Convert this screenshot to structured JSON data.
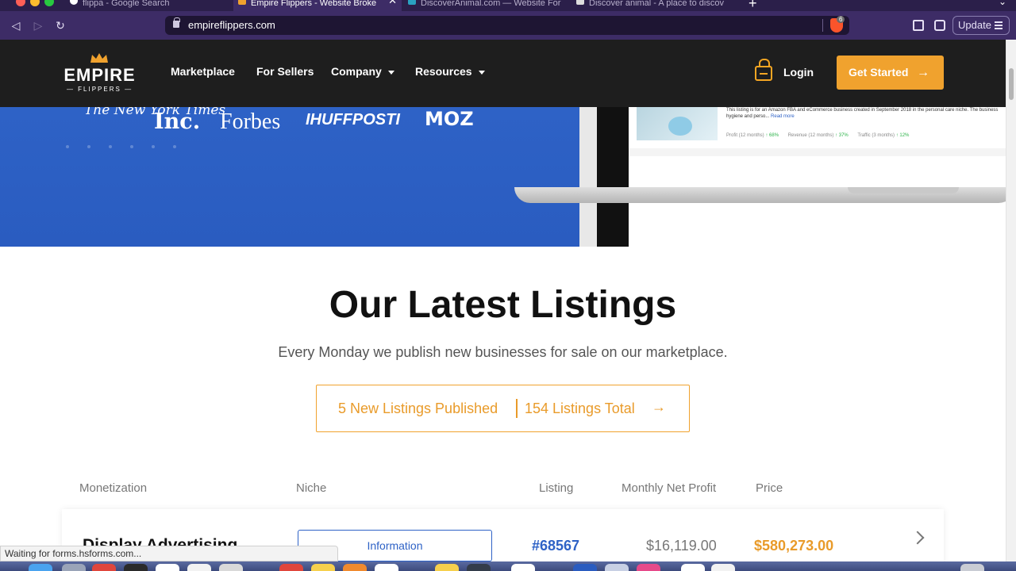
{
  "browser": {
    "tabs": [
      {
        "title": "flippa - Google Search",
        "active": false
      },
      {
        "title": "Empire Flippers - Website Broke",
        "active": true
      },
      {
        "title": "DiscoverAnimal.com — Website For",
        "active": false
      },
      {
        "title": "Discover animal - A place to discov",
        "active": false
      }
    ],
    "url": "empireflippers.com",
    "update_label": "Update",
    "brave_badge": "6",
    "status_text": "Waiting for forms.hsforms.com..."
  },
  "header": {
    "logo_word": "EMPIRE",
    "logo_sub": "— FLIPPERS —",
    "nav": [
      {
        "label": "Marketplace"
      },
      {
        "label": "For Sellers"
      },
      {
        "label": "Company"
      },
      {
        "label": "Resources"
      }
    ],
    "login_label": "Login",
    "cta_label": "Get Started",
    "colors": {
      "accent": "#f0a22e",
      "dark": "#1e1e1e"
    }
  },
  "hero": {
    "press": [
      "The New York Times",
      "Inc.",
      "Forbes",
      "IHUFFPOSTI",
      "MOZ"
    ],
    "preview": {
      "description": "This listing is for an Amazon FBA and eCommerce business created in September 2018 in the personal care niche. The business hygiene and perso...",
      "read_more": "Read more",
      "stats": [
        {
          "label": "Profit (12 months)",
          "value": "↑ 68%"
        },
        {
          "label": "Revenue (12 months)",
          "value": "↑ 37%"
        },
        {
          "label": "Traffic (3 months)",
          "value": "↑ 12%"
        }
      ]
    },
    "colors": {
      "band": "#2e62c6"
    }
  },
  "latest": {
    "title": "Our Latest Listings",
    "subtitle": "Every Monday we publish new businesses for sale on our marketplace.",
    "new_count_label": "5 New Listings Published",
    "total_label": "154 Listings Total",
    "columns": [
      "Monetization",
      "Niche",
      "Listing",
      "Monthly Net Profit",
      "Price"
    ],
    "rows": [
      {
        "monetization": "Display Advertising",
        "niche": "Information",
        "listing": "#68567",
        "profit": "$16,119.00",
        "price": "$580,273.00"
      }
    ]
  }
}
